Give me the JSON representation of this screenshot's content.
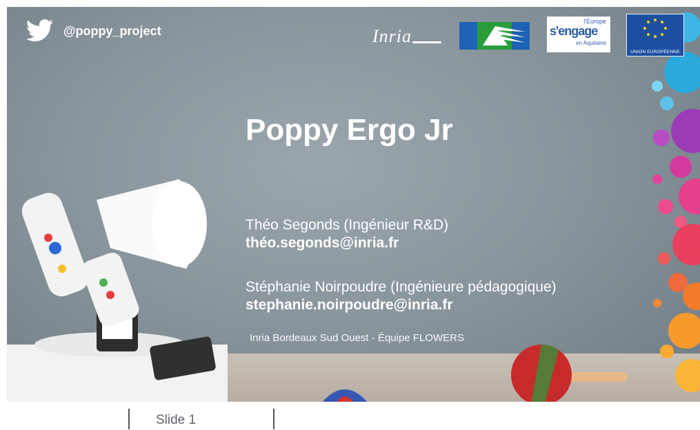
{
  "slide": {
    "twitter_handle": "@poppy_project",
    "logos": {
      "inria": "Inria",
      "europe_top": "l'Europe",
      "europe_main": "s'engage",
      "europe_sub": "en Aquitaine",
      "eu_caption": "UNION EUROPÉENNE"
    },
    "title": "Poppy Ergo Jr",
    "people": [
      {
        "name": "Théo Segonds (Ingénieur R&D)",
        "email": "théo.segonds@inria.fr"
      },
      {
        "name": "Stéphanie Noirpoudre (Ingénieure pédagogique)",
        "email": "stephanie.noirpoudre@inria.fr"
      }
    ],
    "team": "Inria Bordeaux Sud Ouest - Équipe FLOWERS"
  },
  "footer": {
    "slide_label": "Slide 1"
  },
  "colors": {
    "background": "#8a969d",
    "text": "#ffffff",
    "footer_text": "#5f6368"
  },
  "icons": [
    "twitter-bird-icon"
  ]
}
